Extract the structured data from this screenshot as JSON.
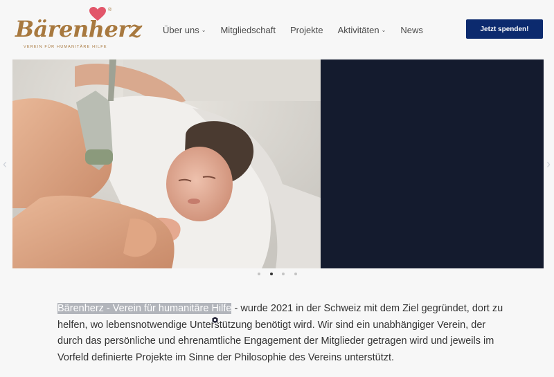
{
  "logo": {
    "wordmark": "Bärenherz",
    "registered": "®",
    "tagline": "VEREIN FÜR HUMANITÄRE HILFE"
  },
  "nav": {
    "items": [
      {
        "label": "Über uns",
        "dropdown": true
      },
      {
        "label": "Mitgliedschaft",
        "dropdown": false
      },
      {
        "label": "Projekte",
        "dropdown": false
      },
      {
        "label": "Aktivitäten",
        "dropdown": true
      },
      {
        "label": "News",
        "dropdown": false
      }
    ],
    "dropdown_icon": "chevron-down-icon"
  },
  "cta": {
    "donate_label": "Jetzt spenden!"
  },
  "slider": {
    "active_slide": 2,
    "slide_count": 4,
    "photo_subject": "newborn baby wrapped in white blanket during ultrasound",
    "prev_icon": "chevron-left-icon",
    "next_icon": "chevron-right-icon"
  },
  "intro": {
    "highlight": "Bärenherz - Verein für humanitäre Hilfe",
    "text": " - wurde 2021 in der Schweiz mit dem Ziel gegründet, dort zu helfen, wo lebensnotwendige Unterstützung benötigt wird. Wir sind ein unabhängiger Verein, der durch das persönliche und ehrenamtliche Engagement der Mitglieder getragen wird und jeweils im Vorfeld definierte Projekte im Sinne der Philosophie des Vereins unterstützt."
  },
  "colors": {
    "brand": "#a8793f",
    "heart": "#e2566a",
    "cta_bg": "#0c2a6e",
    "panel": "#141b2e",
    "page_bg": "#f7f7f7"
  }
}
